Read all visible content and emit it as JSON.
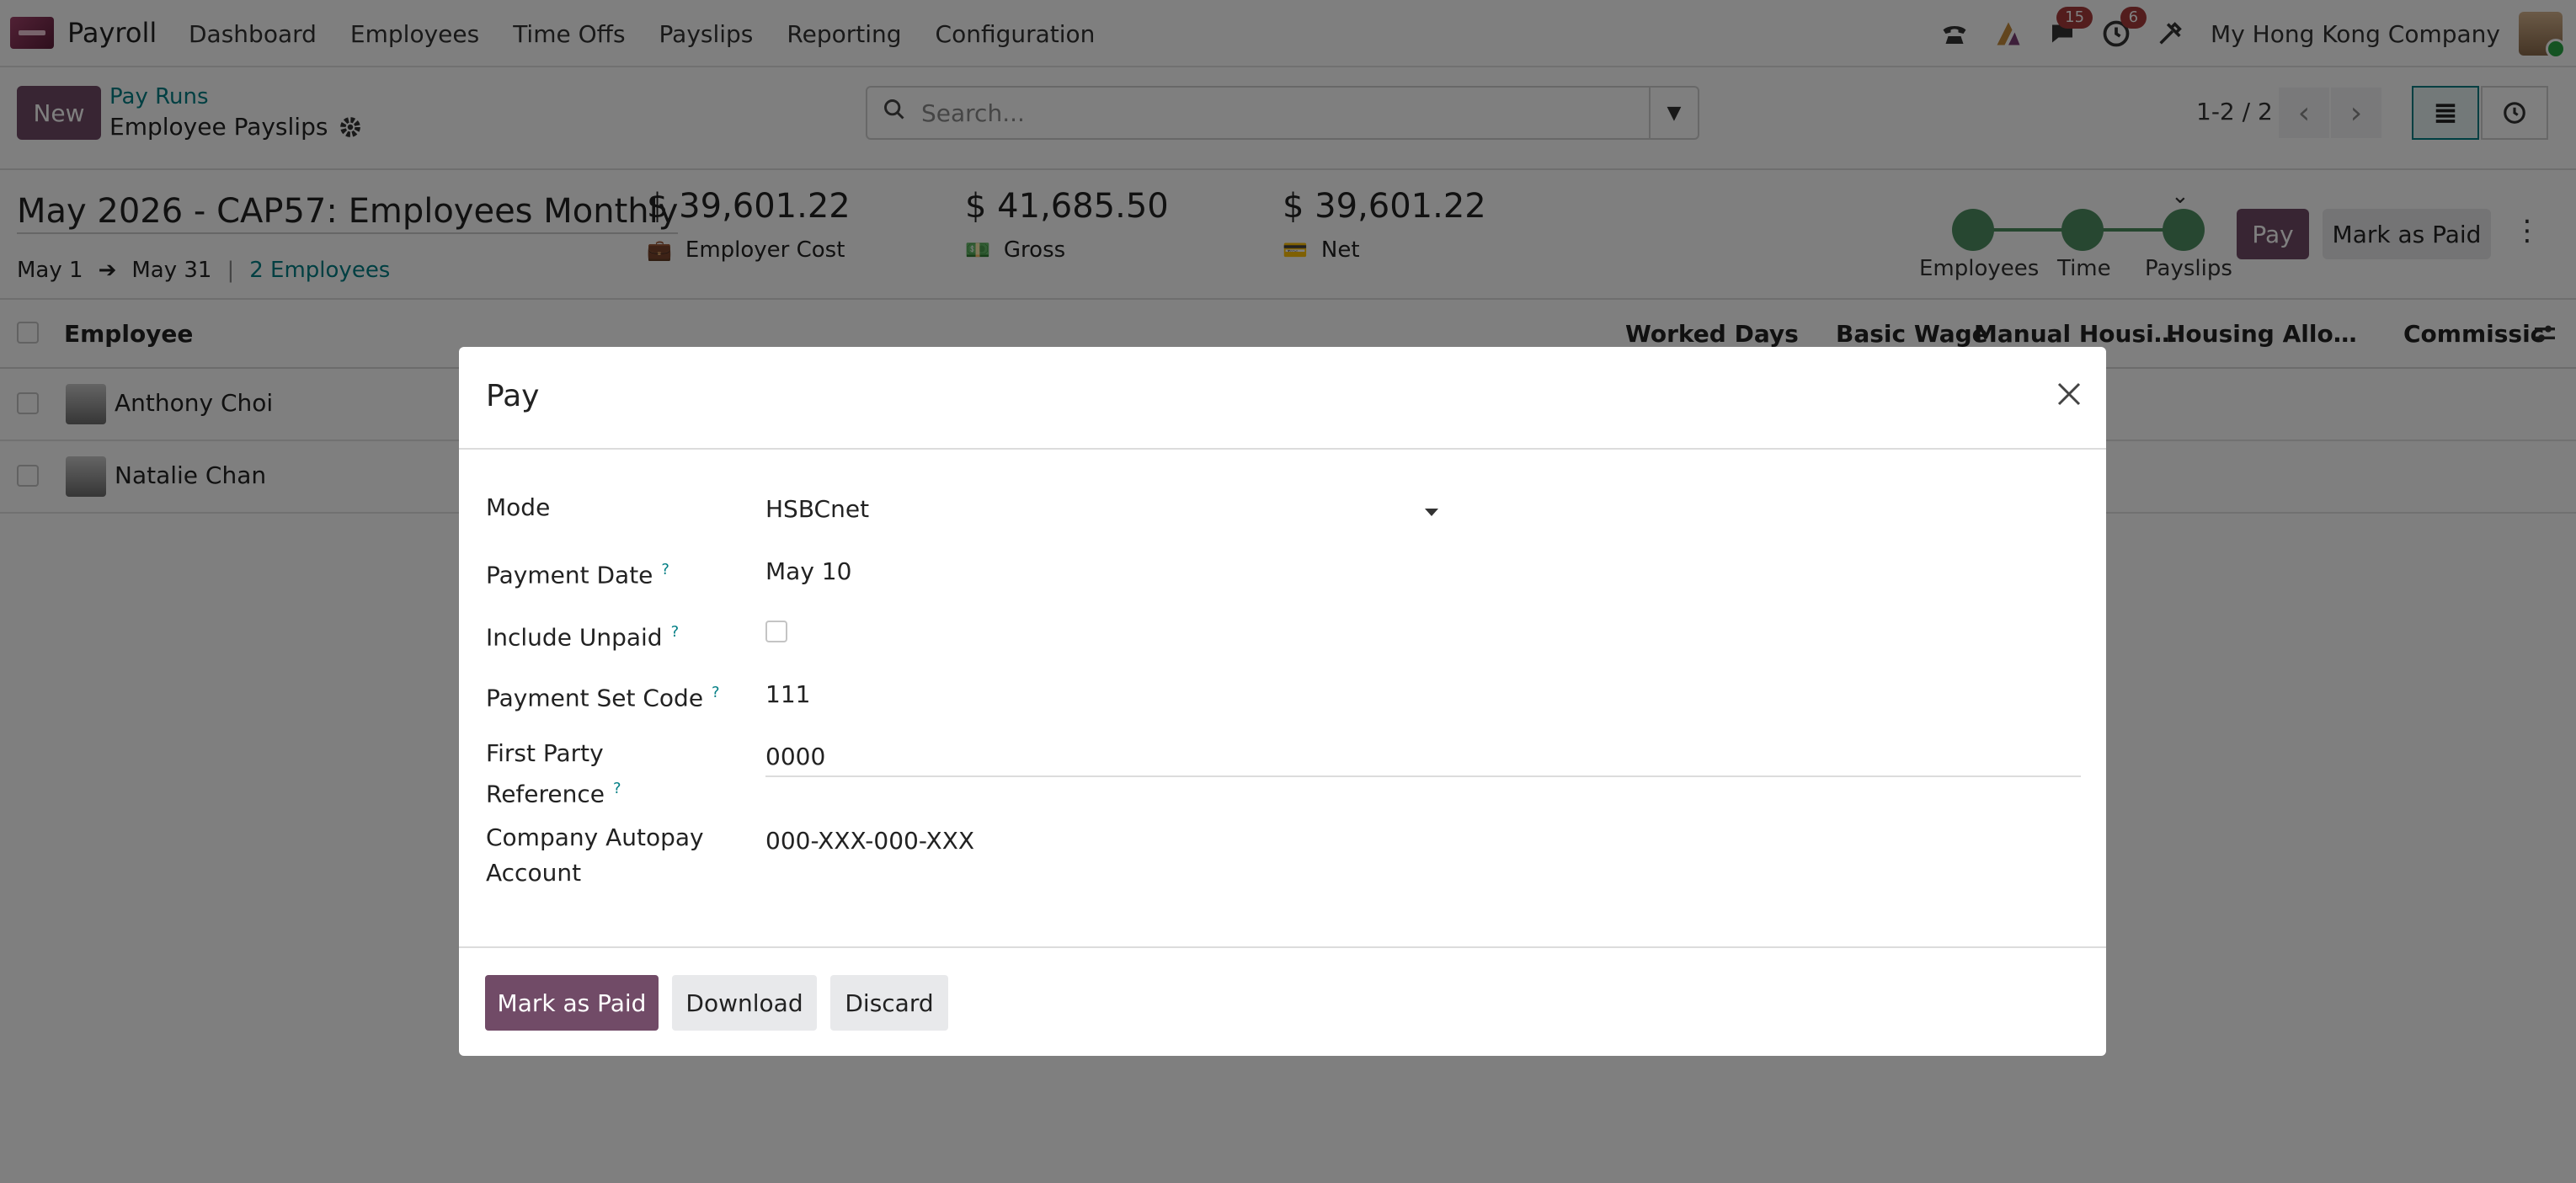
{
  "navbar": {
    "app_name": "Payroll",
    "menu": [
      "Dashboard",
      "Employees",
      "Time Offs",
      "Payslips",
      "Reporting",
      "Configuration"
    ],
    "messages_count": "15",
    "activities_count": "6",
    "company": "My Hong Kong Company"
  },
  "control": {
    "new_label": "New",
    "breadcrumb_parent": "Pay Runs",
    "breadcrumb_current": "Employee Payslips",
    "search_placeholder": "Search...",
    "pager": "1-2 / 2"
  },
  "pay_run": {
    "title": "May 2026 - CAP57: Employees Monthly",
    "date_start": "May 1",
    "date_end": "May 31",
    "employees_link": "2 Employees",
    "employer_cost": "$ 39,601.22",
    "employer_cost_label": "Employer Cost",
    "gross": "$ 41,685.50",
    "gross_label": "Gross",
    "net": "$ 39,601.22",
    "net_label": "Net",
    "steps": [
      "Employees",
      "Time",
      "Payslips"
    ],
    "pay_label": "Pay",
    "mark_paid_label": "Mark as Paid"
  },
  "list": {
    "columns": [
      "Employee",
      "Worked Days",
      "Basic Wage",
      "Manual Housi…",
      "Housing Allo…",
      "Commissic"
    ],
    "rows": [
      {
        "name": "Anthony Choi"
      },
      {
        "name": "Natalie Chan"
      }
    ]
  },
  "modal": {
    "title": "Pay",
    "fields": {
      "mode_label": "Mode",
      "mode_value": "HSBCnet",
      "payment_date_label": "Payment Date",
      "payment_date_value": "May 10",
      "include_unpaid_label": "Include Unpaid",
      "payment_set_code_label": "Payment Set Code",
      "payment_set_code_value": "111",
      "first_party_ref_label_1": "First Party",
      "first_party_ref_label_2": "Reference",
      "first_party_ref_value": "0000",
      "autopay_label_1": "Company Autopay",
      "autopay_label_2": "Account",
      "autopay_value": "000-XXX-000-XXX"
    },
    "buttons": {
      "mark_as_paid": "Mark as Paid",
      "download": "Download",
      "discard": "Discard"
    }
  },
  "colors": {
    "primary": "#714b67",
    "accent_link": "#017e84",
    "step_done": "#4f8f62",
    "badge": "#a73a3a"
  },
  "icons": {
    "close": "close-icon",
    "search": "search-icon",
    "settings": "gear-icon"
  }
}
